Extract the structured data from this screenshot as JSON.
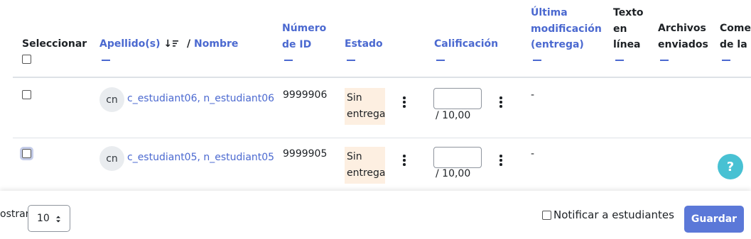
{
  "table": {
    "headers": {
      "select": "Seleccionar",
      "surname": "Apellido(s)",
      "sort_indicator": "↓",
      "separator": "/",
      "firstname": "Nombre",
      "idnumber": [
        "Número",
        "de ID"
      ],
      "status": "Estado",
      "grade": "Calificación",
      "lastmodified": [
        "Última",
        "modificación",
        "(entrega)"
      ],
      "onlinetext": [
        "Texto",
        "en",
        "línea"
      ],
      "files": [
        "Archivos",
        "enviados"
      ],
      "comments": [
        "Comer",
        "de la e"
      ]
    },
    "rows": [
      {
        "initials": "cn",
        "fullname": "c_estudiant06, n_estudiant06",
        "idnumber": "9999906",
        "status": [
          "Sin",
          "entrega"
        ],
        "grade_value": "",
        "grade_max": "/ 10,00",
        "lastmodified": "-"
      },
      {
        "initials": "cn",
        "fullname": "c_estudiant05, n_estudiant05",
        "idnumber": "9999905",
        "status": [
          "Sin",
          "entrega"
        ],
        "grade_value": "",
        "grade_max": "/ 10,00",
        "lastmodified": "-"
      }
    ]
  },
  "footer": {
    "show_label": "ostrar",
    "perpage_value": "10",
    "notify_label": "Notificar a estudiantes",
    "save_label": "Guardar"
  },
  "help": {
    "label": "?"
  },
  "colors": {
    "link": "#4b69d0",
    "status_bg": "#fdefe1",
    "button": "#5b78d8",
    "help": "#48c1d3"
  }
}
